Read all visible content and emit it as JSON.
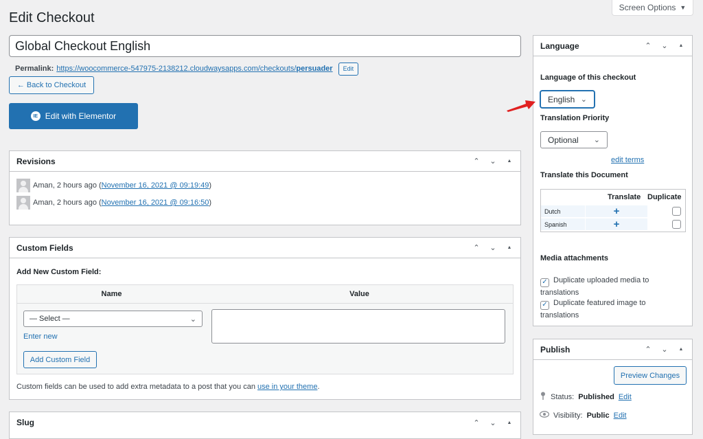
{
  "header": {
    "screen_options": "Screen Options",
    "page_title": "Edit Checkout"
  },
  "post": {
    "title_value": "Global Checkout English",
    "permalink_label": "Permalink:",
    "permalink_base": "https://woocommerce-547975-2138212.cloudwaysapps.com/checkouts/",
    "permalink_slug": "persuader",
    "edit_label": "Edit",
    "back_label": "← Back to Checkout",
    "elementor_label": "Edit with Elementor"
  },
  "revisions": {
    "title": "Revisions",
    "items": [
      {
        "author": "Aman, 2 hours ago (",
        "link": "November 16, 2021 @ 09:19:49",
        "close": ")"
      },
      {
        "author": "Aman, 2 hours ago (",
        "link": "November 16, 2021 @ 09:16:50",
        "close": ")"
      }
    ]
  },
  "custom_fields": {
    "title": "Custom Fields",
    "add_new_heading": "Add New Custom Field:",
    "col_name": "Name",
    "col_value": "Value",
    "select_value": "— Select —",
    "enter_new": "Enter new",
    "add_button": "Add Custom Field",
    "note_prefix": "Custom fields can be used to add extra metadata to a post that you can ",
    "note_link": "use in your theme",
    "note_suffix": "."
  },
  "slug": {
    "title": "Slug"
  },
  "language": {
    "title": "Language",
    "language_label": "Language of this checkout",
    "language_value": "English",
    "priority_label": "Translation Priority",
    "priority_value": "Optional",
    "edit_terms": "edit terms",
    "translate_doc_label": "Translate this Document",
    "col_translate": "Translate",
    "col_duplicate": "Duplicate",
    "languages": [
      {
        "name": "Dutch",
        "duplicate": false
      },
      {
        "name": "Spanish",
        "duplicate": false
      }
    ],
    "media_label": "Media attachments",
    "media_options": [
      {
        "label": "Duplicate uploaded media to translations",
        "checked": true
      },
      {
        "label": "Duplicate featured image to translations",
        "checked": true
      }
    ]
  },
  "publish": {
    "title": "Publish",
    "preview_button": "Preview Changes",
    "status_label": "Status:",
    "status_value": "Published",
    "status_edit": "Edit",
    "visibility_label": "Visibility:",
    "visibility_value": "Public",
    "visibility_edit": "Edit"
  },
  "colors": {
    "accent": "#2271b1",
    "arrow": "#e02020"
  }
}
